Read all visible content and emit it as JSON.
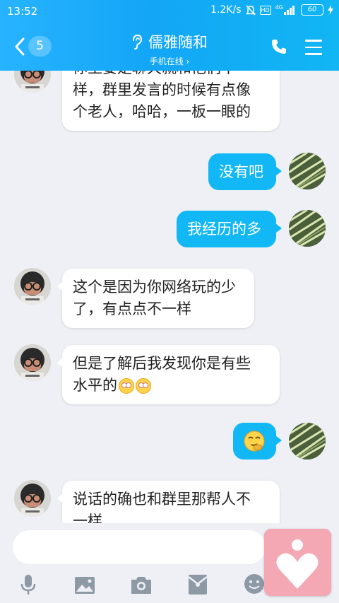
{
  "status_bar": {
    "time": "13:52",
    "net_speed": "1.2K/s",
    "hd_label": "HD",
    "network": "4G",
    "battery": "60"
  },
  "header": {
    "back_count": "5",
    "contact_name": "儒雅随和",
    "subtitle": "手机在线 ›"
  },
  "messages": [
    {
      "side": "in",
      "text_line1": "你主要是聊天就和他们不一",
      "text_line2": "样，群里发言的时候有点像",
      "text_line3": "个老人，哈哈，一板一眼的"
    },
    {
      "side": "out",
      "text": "没有吧"
    },
    {
      "side": "out",
      "text": "我经历的多"
    },
    {
      "side": "in",
      "text_line1": "这个是因为你网络玩的少",
      "text_line2": "了，有点点不一样"
    },
    {
      "side": "in",
      "text_line1": "但是了解后我发现你是有些",
      "text_line2": "水平的"
    },
    {
      "side": "out",
      "emoji": "thinking-emoji"
    },
    {
      "side": "in",
      "text_line1": "说话的确也和群里那帮人不",
      "text_line2": "一样"
    }
  ],
  "colors": {
    "header_blue": "#12b7f5",
    "out_bubble": "#12b7f5",
    "in_bubble": "#ffffff",
    "background": "#eef0f5",
    "heart_card": "#f3a8b4"
  },
  "toolbar": [
    "microphone-icon",
    "image-icon",
    "camera-icon",
    "red-packet-icon",
    "emoji-icon"
  ]
}
